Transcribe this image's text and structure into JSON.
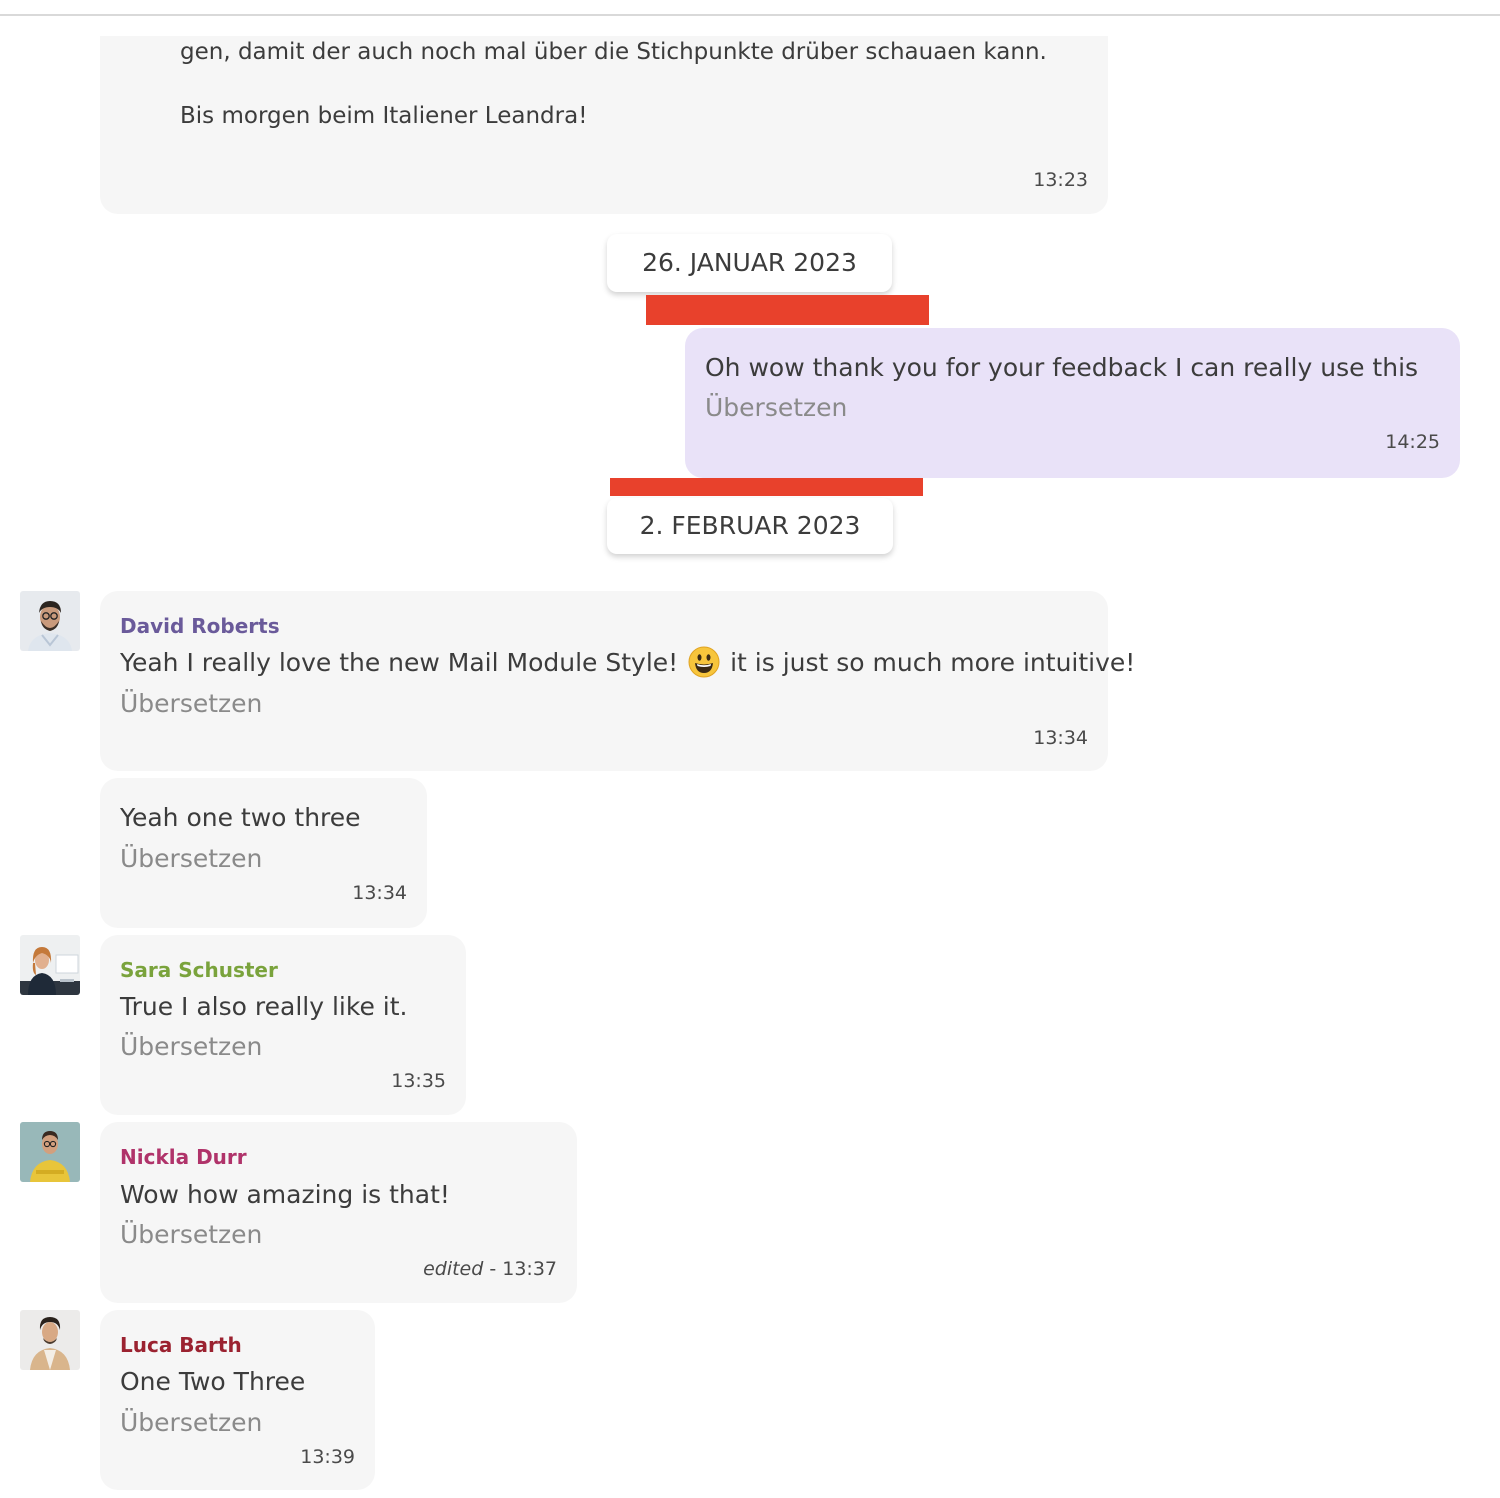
{
  "continued_message": {
    "line1": "gen, damit der auch noch mal über die Stichpunkte drüber schauaen kann.",
    "line2": "Bis morgen beim Italiener Leandra!",
    "time": "13:23"
  },
  "date_separators": [
    {
      "label": "26. JANUAR 2023"
    },
    {
      "label": "2. FEBRUAR 2023"
    }
  ],
  "own_message": {
    "text": "Oh wow thank you for your feedback I can really use this",
    "translate": "Übersetzen",
    "time": "14:25"
  },
  "messages": [
    {
      "sender": "David Roberts",
      "sender_color": "#6a5a9a",
      "text_before_emoji": "Yeah I really love the new Mail Module Style!",
      "emoji": "grinning-face",
      "text_after_emoji": "it is just so much more intuitive!",
      "translate": "Übersetzen",
      "time": "13:34"
    },
    {
      "text": "Yeah one two three",
      "translate": "Übersetzen",
      "time": "13:34"
    },
    {
      "sender": "Sara Schuster",
      "sender_color": "#7aa33c",
      "text": "True I also really like it.",
      "translate": "Übersetzen",
      "time": "13:35"
    },
    {
      "sender": "Nickla Durr",
      "sender_color": "#b0336a",
      "text": "Wow how amazing is that!",
      "translate": "Übersetzen",
      "edited_label": "edited",
      "time_sep": " - ",
      "time": "13:37"
    },
    {
      "sender": "Luca Barth",
      "sender_color": "#9b2230",
      "text": "One Two Three",
      "translate": "Übersetzen",
      "time": "13:39"
    }
  ],
  "colors": {
    "own_bubble": "#e9e2f8",
    "other_bubble": "#f6f6f6",
    "redaction_bar": "#e8412c"
  }
}
